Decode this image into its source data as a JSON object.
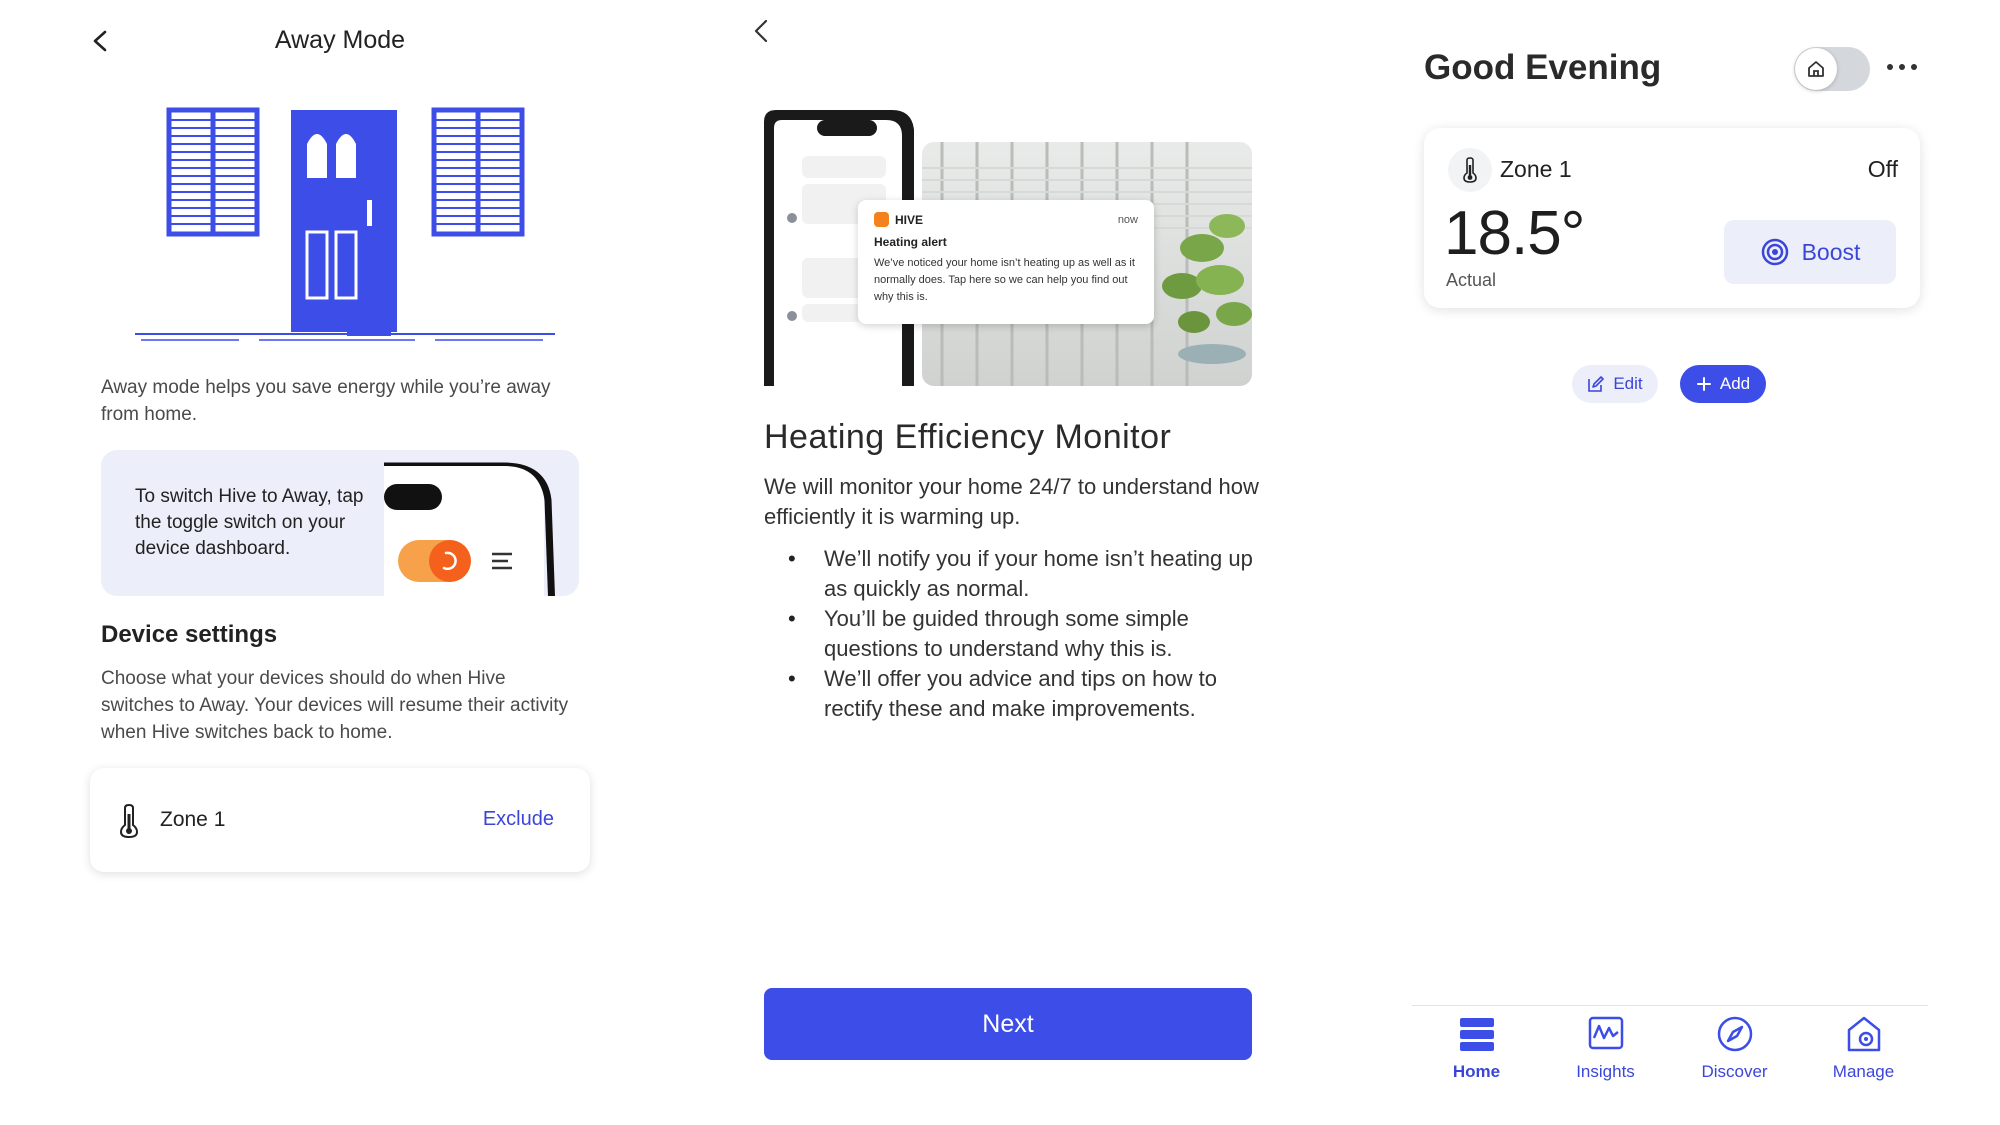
{
  "away_mode": {
    "title": "Away Mode",
    "description": "Away mode helps you save energy while you’re away from home.",
    "tip_card": {
      "text": "To switch Hive to Away, tap the toggle switch on your device dashboard."
    },
    "device_settings": {
      "heading": "Device settings",
      "description": "Choose what your devices should do when Hive switches to Away. Your devices will resume their activity when Hive switches back to home."
    },
    "zone_card": {
      "name": "Zone 1",
      "action": "Exclude"
    }
  },
  "efficiency": {
    "notification": {
      "app": "HIVE",
      "time": "now",
      "title": "Heating alert",
      "body": "We’ve noticed your home isn’t heating up as well as it normally does. Tap here so we can help you find out why this is."
    },
    "title": "Heating Efficiency Monitor",
    "intro": "We will monitor your home 24/7 to understand how efficiently it is warming up.",
    "bullets": [
      "We’ll notify you if your home isn’t heating up as quickly as normal.",
      "You’ll be guided through some simple questions to understand why this is.",
      "We’ll offer you advice and tips on how to rectify these and make improvements."
    ],
    "next_label": "Next"
  },
  "dashboard": {
    "greeting": "Good Evening",
    "zone": {
      "name": "Zone 1",
      "status": "Off",
      "temperature": "18.5°",
      "temperature_label": "Actual",
      "boost_label": "Boost"
    },
    "edit_label": "Edit",
    "add_label": "Add",
    "nav": [
      {
        "label": "Home",
        "icon": "home-stack-icon",
        "active": true
      },
      {
        "label": "Insights",
        "icon": "insights-chart-icon",
        "active": false
      },
      {
        "label": "Discover",
        "icon": "compass-icon",
        "active": false
      },
      {
        "label": "Manage",
        "icon": "house-gear-icon",
        "active": false
      }
    ],
    "accent_color": "#3d4ee8"
  }
}
